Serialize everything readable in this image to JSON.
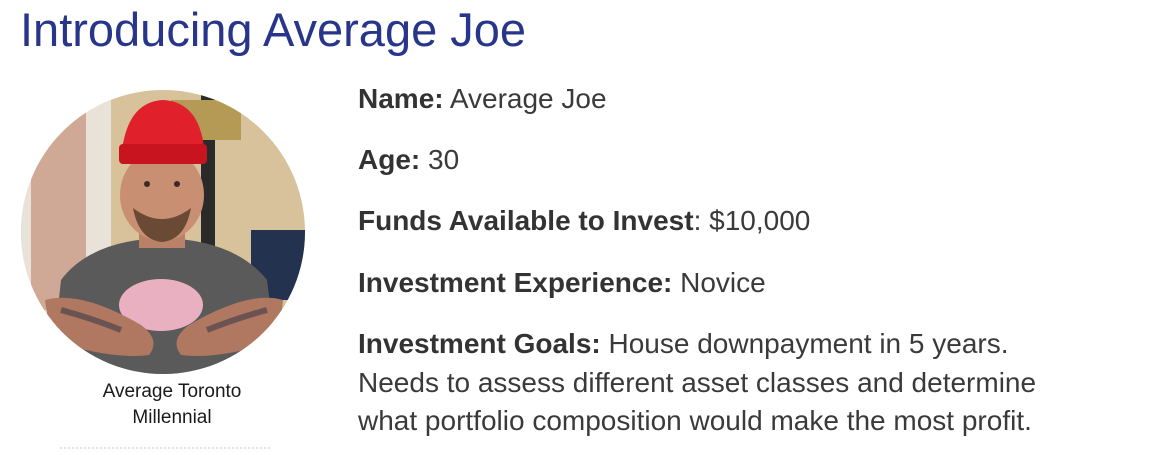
{
  "title": "Introducing Average Joe",
  "portrait": {
    "icon": "person-photo-icon",
    "caption_line1": "Average Toronto",
    "caption_line2": "Millennial",
    "colors": {
      "hat": "#e0202a",
      "shirt": "#5a5a5a",
      "skin": "#c98f72",
      "background": "#d8c29b"
    }
  },
  "profile": {
    "name_label": "Name:",
    "name_value": " Average Joe",
    "age_label": "Age:",
    "age_value": " 30",
    "funds_label": "Funds Available to Invest",
    "funds_value": ": $10,000",
    "experience_label": "Investment Experience:",
    "experience_value": " Novice",
    "goals_label": "Investment Goals:",
    "goals_line1": " House downpayment in 5 years.",
    "goals_line2": "Needs to assess different asset classes and determine",
    "goals_line3": "what portfolio composition would make the most profit."
  },
  "colors": {
    "title": "#27368a",
    "body_text": "#3a3a3a"
  }
}
